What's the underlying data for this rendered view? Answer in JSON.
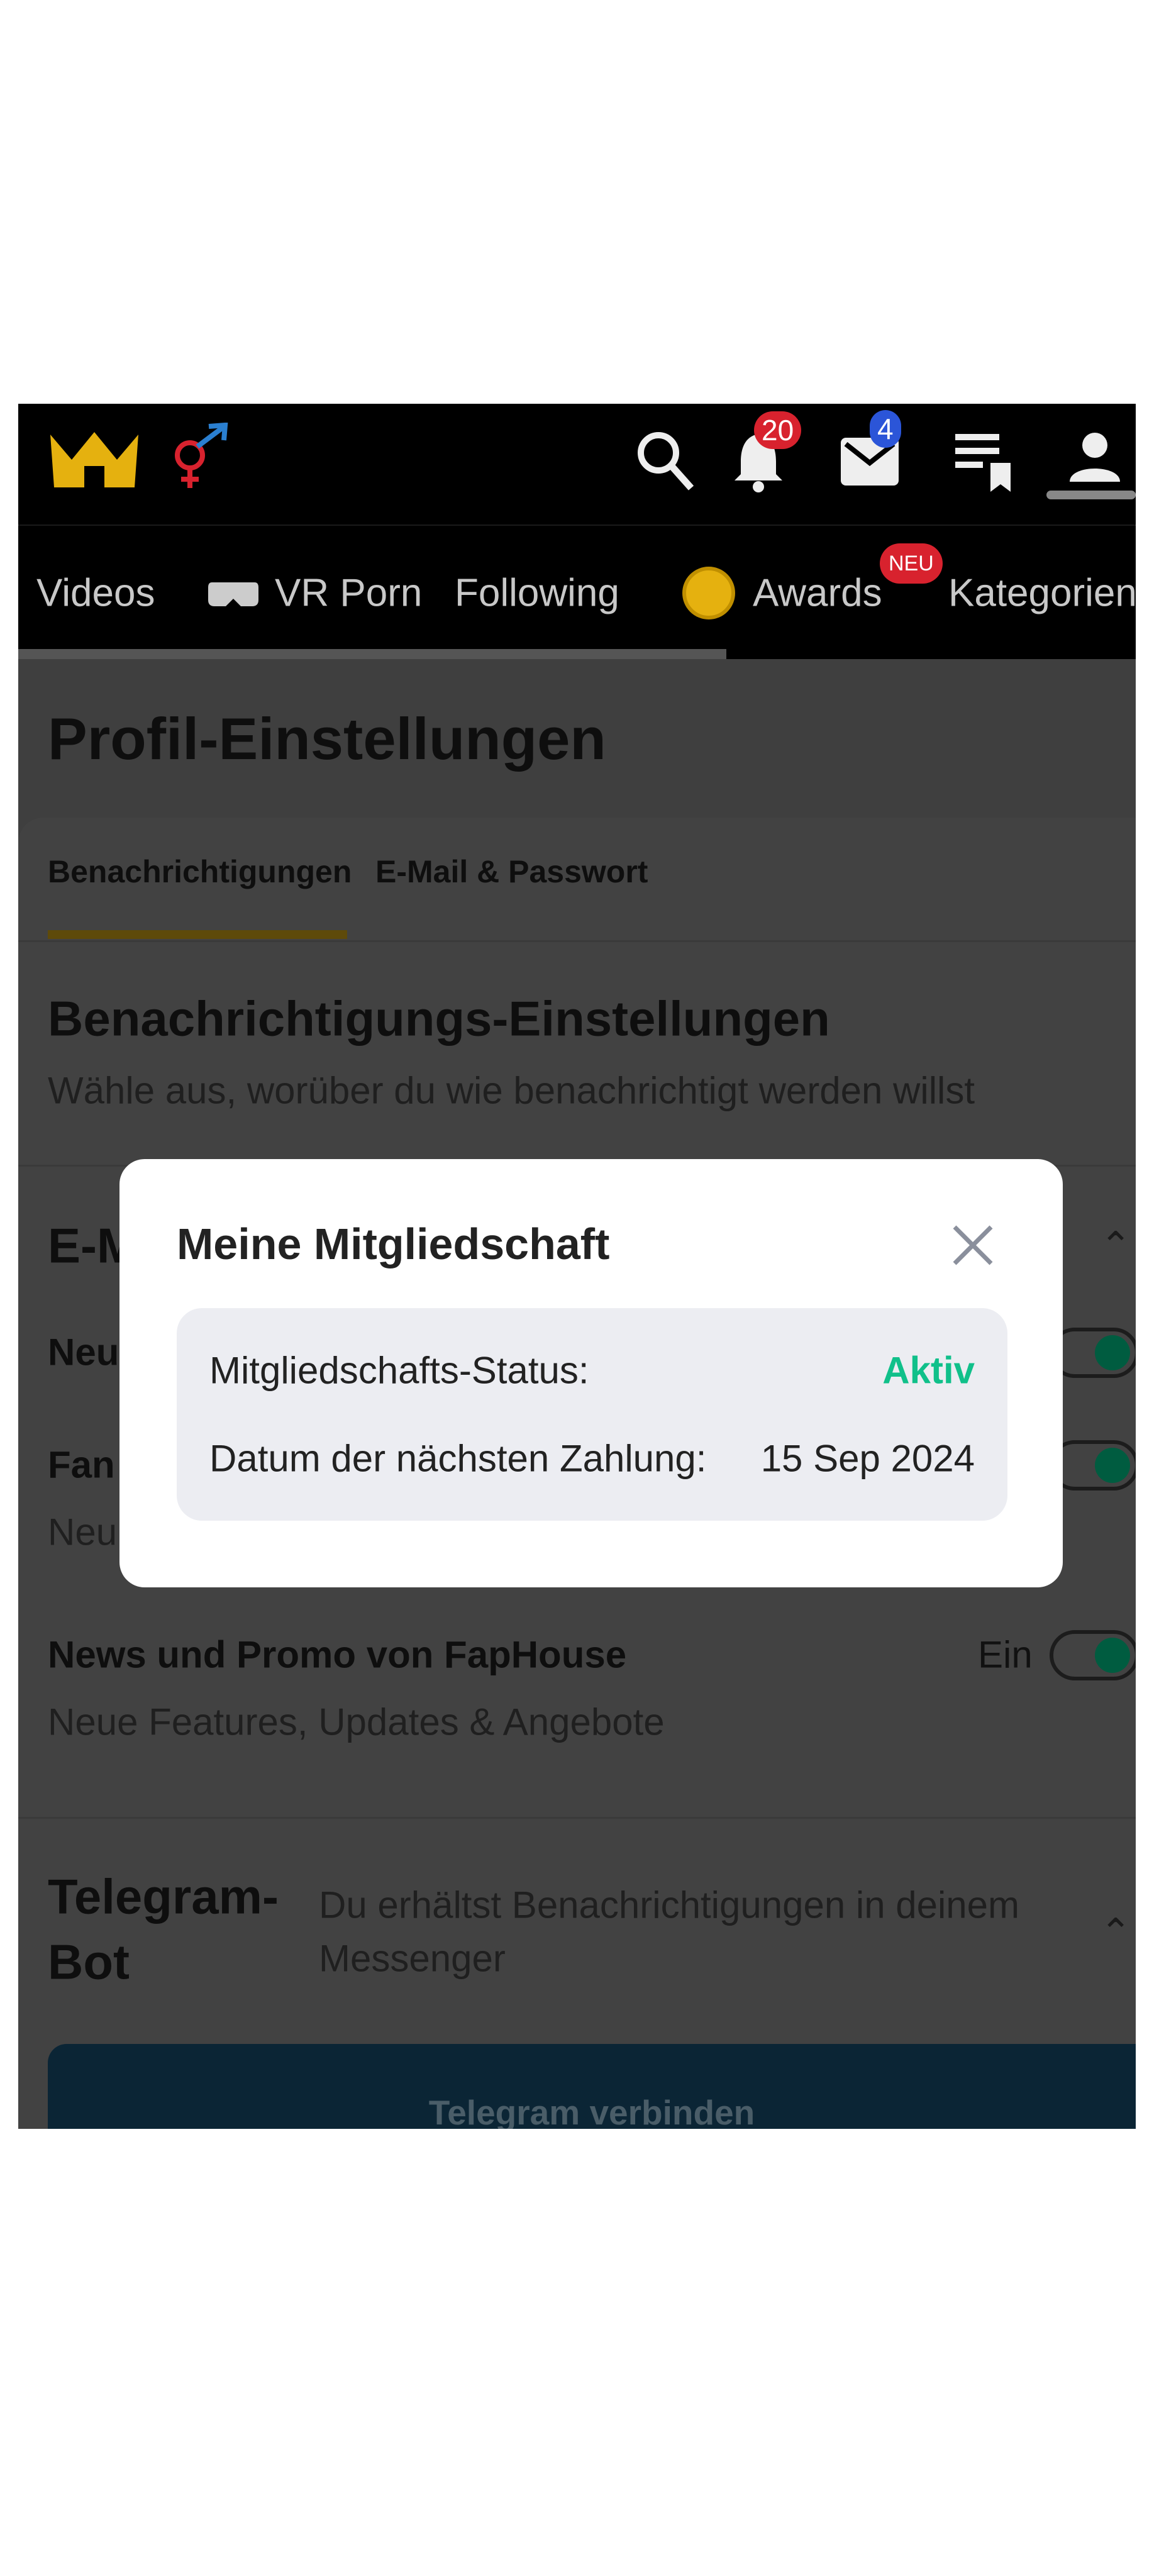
{
  "header": {
    "logo": "crown-logo",
    "orientation_icon": "gender-symbol-icon",
    "notifications_count": "20",
    "messages_count": "4",
    "colors": {
      "brand": "#e5b10f",
      "notif_badge": "#d8222e",
      "msg_badge": "#2b55d8"
    }
  },
  "nav": {
    "items": [
      {
        "label": "Videos"
      },
      {
        "label": "VR Porn",
        "icon": "vr-headset-icon"
      },
      {
        "label": "Following"
      },
      {
        "label": "Awards",
        "icon": "award-coin-icon",
        "badge": "NEU"
      },
      {
        "label": "Kategorien"
      }
    ]
  },
  "page": {
    "title": "Profil-Einstellungen",
    "tabs": [
      {
        "label": "Benachrichtigungen",
        "active": true
      },
      {
        "label": "E-Mail & Passwort"
      }
    ],
    "section_title": "Benachrichtigungs-Einstellungen",
    "section_subtitle": "Wähle aus, worüber du wie benachrichtigt werden willst",
    "email_group_title": "E-M",
    "rows": [
      {
        "title": "Neu",
        "on": true
      },
      {
        "title": "Fan",
        "subtitle": "Neu",
        "on": true
      },
      {
        "title": "News und Promo von FapHouse",
        "subtitle": "Neue Features, Updates & Angebote",
        "state_label": "Ein",
        "on": true
      }
    ],
    "telegram": {
      "title_line1": "Telegram-",
      "title_line2": "Bot",
      "desc_line1": "Du erhältst Benachrichtigungen in deinem",
      "desc_line2": "Messenger",
      "button": "Telegram verbinden"
    }
  },
  "modal": {
    "title": "Meine Mitgliedschaft",
    "status_label": "Mitgliedschafts-Status:",
    "status_value": "Aktiv",
    "status_color": "#10c08a",
    "next_payment_label": "Datum der nächsten Zahlung:",
    "next_payment_value": "15 Sep 2024"
  }
}
